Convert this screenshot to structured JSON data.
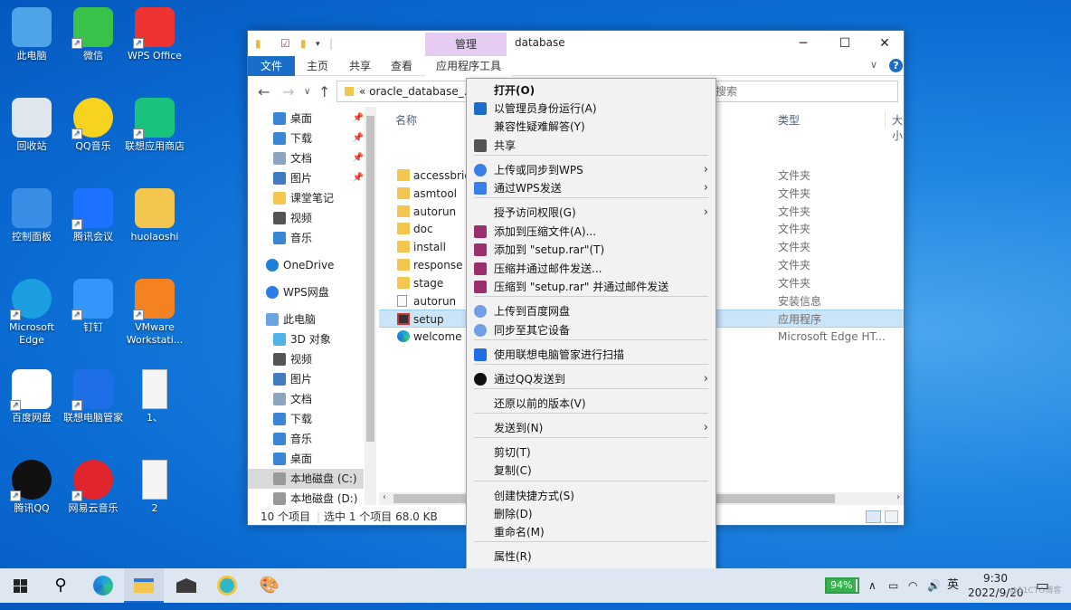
{
  "desktop": {
    "icons": [
      {
        "label": "此电脑",
        "icon": "computer-icon"
      },
      {
        "label": "微信",
        "icon": "wechat-icon"
      },
      {
        "label": "WPS Office",
        "icon": "wps-icon"
      },
      {
        "label": "回收站",
        "icon": "recycle-bin-icon"
      },
      {
        "label": "QQ音乐",
        "icon": "qqmusic-icon"
      },
      {
        "label": "联想应用商店",
        "icon": "lenovo-store-icon"
      },
      {
        "label": "控制面板",
        "icon": "control-panel-icon"
      },
      {
        "label": "腾讯会议",
        "icon": "tencent-meeting-icon"
      },
      {
        "label": "huolaoshi",
        "icon": "folder-icon"
      },
      {
        "label": "Microsoft Edge",
        "icon": "edge-icon"
      },
      {
        "label": "钉钉",
        "icon": "dingtalk-icon"
      },
      {
        "label": "VMware Workstati...",
        "icon": "vmware-icon"
      },
      {
        "label": "百度网盘",
        "icon": "baidu-netdisk-icon"
      },
      {
        "label": "联想电脑管家",
        "icon": "lenovo-manager-icon"
      },
      {
        "label": "1、",
        "icon": "document-icon"
      },
      {
        "label": "腾讯QQ",
        "icon": "qq-icon"
      },
      {
        "label": "网易云音乐",
        "icon": "netease-music-icon"
      },
      {
        "label": "2",
        "icon": "document-icon"
      }
    ]
  },
  "explorer": {
    "title": "database",
    "manage_tab": "管理",
    "tabs": {
      "file": "文件",
      "home": "主页",
      "share": "共享",
      "view": "查看",
      "app_tools": "应用程序工具"
    },
    "address": "« oracle_database_...",
    "search_placeholder": "搜索",
    "nav": [
      {
        "label": "桌面",
        "pinned": true
      },
      {
        "label": "下载",
        "pinned": true
      },
      {
        "label": "文档",
        "pinned": true
      },
      {
        "label": "图片",
        "pinned": true
      },
      {
        "label": "课堂笔记",
        "pinned": false
      },
      {
        "label": "视频",
        "pinned": false
      },
      {
        "label": "音乐",
        "pinned": false
      },
      {
        "label": "OneDrive",
        "pinned": false
      },
      {
        "label": "WPS网盘",
        "pinned": false
      },
      {
        "label": "此电脑",
        "pinned": false
      },
      {
        "label": "3D 对象",
        "pinned": false
      },
      {
        "label": "视频",
        "pinned": false
      },
      {
        "label": "图片",
        "pinned": false
      },
      {
        "label": "文档",
        "pinned": false
      },
      {
        "label": "下载",
        "pinned": false
      },
      {
        "label": "音乐",
        "pinned": false
      },
      {
        "label": "桌面",
        "pinned": false
      },
      {
        "label": "本地磁盘 (C:)",
        "pinned": false
      },
      {
        "label": "本地磁盘 (D:)",
        "pinned": false
      }
    ],
    "columns": {
      "name": "名称",
      "type": "类型",
      "size": "大小"
    },
    "files": [
      {
        "name": "accessbridg",
        "type": "文件夹",
        "kind": "folder"
      },
      {
        "name": "asmtool",
        "type": "文件夹",
        "kind": "folder"
      },
      {
        "name": "autorun",
        "type": "文件夹",
        "kind": "folder"
      },
      {
        "name": "doc",
        "type": "文件夹",
        "kind": "folder"
      },
      {
        "name": "install",
        "type": "文件夹",
        "kind": "folder"
      },
      {
        "name": "response",
        "type": "文件夹",
        "kind": "folder"
      },
      {
        "name": "stage",
        "type": "文件夹",
        "kind": "folder"
      },
      {
        "name": "autorun",
        "type": "安装信息",
        "kind": "inf"
      },
      {
        "name": "setup",
        "type": "应用程序",
        "kind": "exe"
      },
      {
        "name": "welcome",
        "type": "Microsoft Edge HT...",
        "kind": "edge"
      }
    ],
    "status_count": "10 个项目",
    "status_selected": "选中 1 个项目  68.0 KB"
  },
  "context_menu": [
    {
      "label": "打开(O)",
      "bold": true
    },
    {
      "label": "以管理员身份运行(A)",
      "icon": "shield-icon"
    },
    {
      "label": "兼容性疑难解答(Y)"
    },
    {
      "label": "共享",
      "icon": "share-icon"
    },
    {
      "label": "上传或同步到WPS",
      "icon": "wps-cloud-icon",
      "sub": true
    },
    {
      "label": "通过WPS发送",
      "icon": "wps-send-icon",
      "sub": true
    },
    {
      "label": "授予访问权限(G)",
      "sub": true
    },
    {
      "label": "添加到压缩文件(A)...",
      "icon": "winrar-icon"
    },
    {
      "label": "添加到 \"setup.rar\"(T)",
      "icon": "winrar-icon"
    },
    {
      "label": "压缩并通过邮件发送...",
      "icon": "winrar-icon"
    },
    {
      "label": "压缩到 \"setup.rar\" 并通过邮件发送",
      "icon": "winrar-icon"
    },
    {
      "label": "上传到百度网盘",
      "icon": "baidu-icon"
    },
    {
      "label": "同步至其它设备",
      "icon": "baidu-icon"
    },
    {
      "label": "使用联想电脑管家进行扫描",
      "icon": "lenovo-shield-icon"
    },
    {
      "label": "通过QQ发送到",
      "icon": "qq-icon",
      "sub": true
    },
    {
      "label": "还原以前的版本(V)"
    },
    {
      "label": "发送到(N)",
      "sub": true
    },
    {
      "label": "剪切(T)"
    },
    {
      "label": "复制(C)"
    },
    {
      "label": "创建快捷方式(S)"
    },
    {
      "label": "删除(D)"
    },
    {
      "label": "重命名(M)"
    },
    {
      "label": "属性(R)"
    }
  ],
  "taskbar": {
    "battery": "94%",
    "ime": "英",
    "time": "9:30",
    "date": "2022/9/20",
    "watermark": "@51CTO博客"
  }
}
